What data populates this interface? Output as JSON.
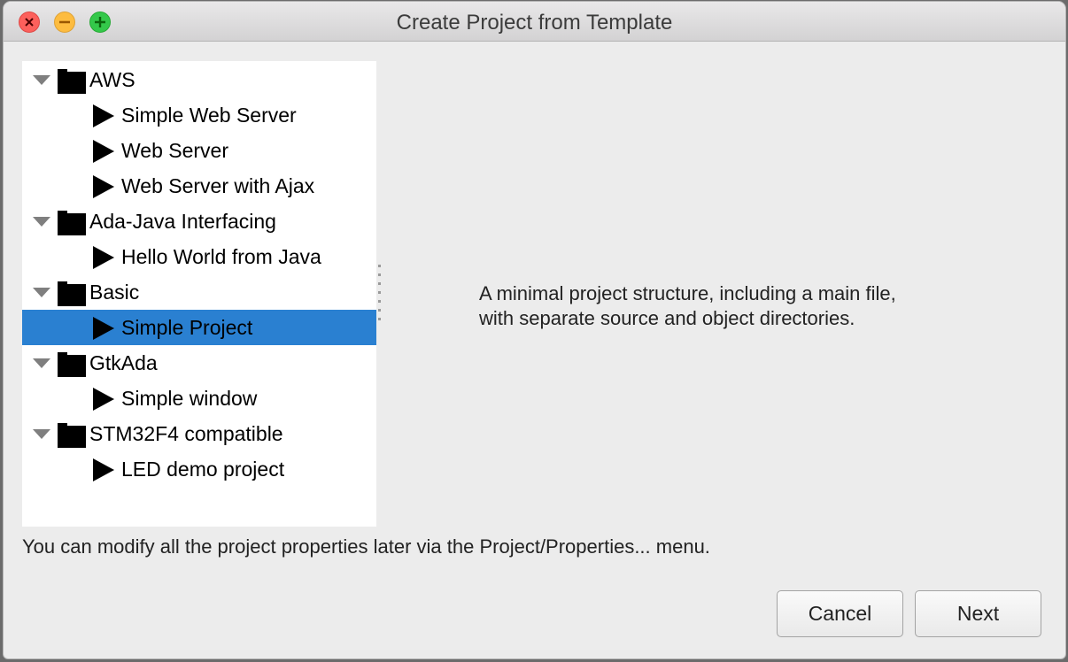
{
  "window": {
    "title": "Create Project from Template",
    "controls": [
      "close",
      "minimize",
      "zoom"
    ]
  },
  "tree": {
    "categories": [
      {
        "label": "AWS",
        "expanded": true,
        "items": [
          "Simple Web Server",
          "Web Server",
          "Web Server with Ajax"
        ]
      },
      {
        "label": "Ada-Java Interfacing",
        "expanded": true,
        "items": [
          "Hello World from Java"
        ]
      },
      {
        "label": "Basic",
        "expanded": true,
        "items": [
          "Simple Project"
        ]
      },
      {
        "label": "GtkAda",
        "expanded": true,
        "items": [
          "Simple window"
        ]
      },
      {
        "label": "STM32F4 compatible",
        "expanded": true,
        "items": [
          "LED demo project"
        ]
      }
    ],
    "selected": "Simple Project",
    "selection_color": "#2a80d1"
  },
  "description": {
    "line1": "A minimal project structure, including a main file,",
    "line2": "with separate source and object directories."
  },
  "hint": "You can modify all the project properties later via the Project/Properties... menu.",
  "buttons": {
    "cancel": "Cancel",
    "next": "Next"
  }
}
